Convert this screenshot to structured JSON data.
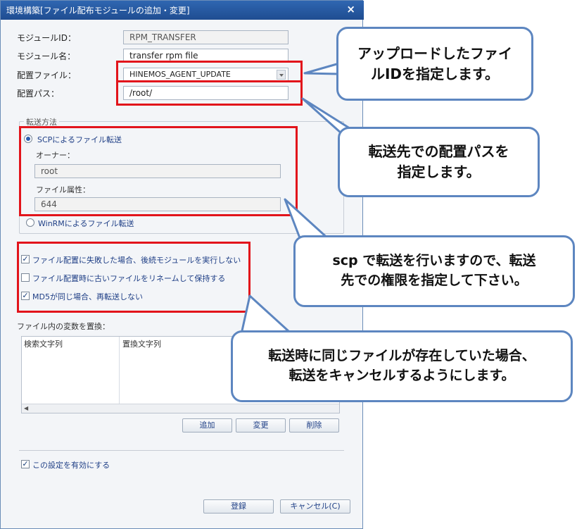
{
  "dialog": {
    "title": "環境構築[ファイル配布モジュールの追加・変更]",
    "close_glyph": "×"
  },
  "form": {
    "module_id_label": "モジュールID：",
    "module_id_value": "RPM_TRANSFER",
    "module_name_label": "モジュール名：",
    "module_name_value": "transfer rpm file",
    "deploy_file_label": "配置ファイル：",
    "deploy_file_value": "HINEMOS_AGENT_UPDATE",
    "deploy_path_label": "配置パス：",
    "deploy_path_value": "/root/"
  },
  "transfer": {
    "group_title": "転送方法",
    "scp_label": "SCPによるファイル転送",
    "owner_label": "オーナー：",
    "owner_value": "root",
    "attr_label": "ファイル属性：",
    "attr_value": "644",
    "winrm_label": "WinRMによるファイル転送"
  },
  "options": {
    "opt1": "ファイル配置に失敗した場合、後続モジュールを実行しない",
    "opt2": "ファイル配置時に古いファイルをリネームして保持する",
    "opt3": "MD5が同じ場合、再転送しない",
    "check_glyph": "✓"
  },
  "replace": {
    "label": "ファイル内の変数を置換：",
    "col_search": "検索文字列",
    "col_replace": "置換文字列",
    "btn_add": "追加",
    "btn_change": "変更",
    "btn_delete": "削除"
  },
  "footer": {
    "enable_label": "この設定を有効にする",
    "register_button": "登録",
    "cancel_button": "キャンセル(C)"
  },
  "callouts": {
    "c1_line1": "アップロードしたファイ",
    "c1_line2": "ルIDを指定します。",
    "c2_line1": "転送先での配置パスを",
    "c2_line2": "指定します。",
    "c3_line1": "scp で転送を行いますので、転送",
    "c3_line2": "先での権限を指定して下さい。",
    "c4_line1": "転送時に同じファイルが存在していた場合、",
    "c4_line2": "転送をキャンセルするようにします。"
  },
  "colors": {
    "annotation_red": "#e2141b",
    "callout_border": "#5d86c0",
    "title_bar": "#2f66b1"
  }
}
